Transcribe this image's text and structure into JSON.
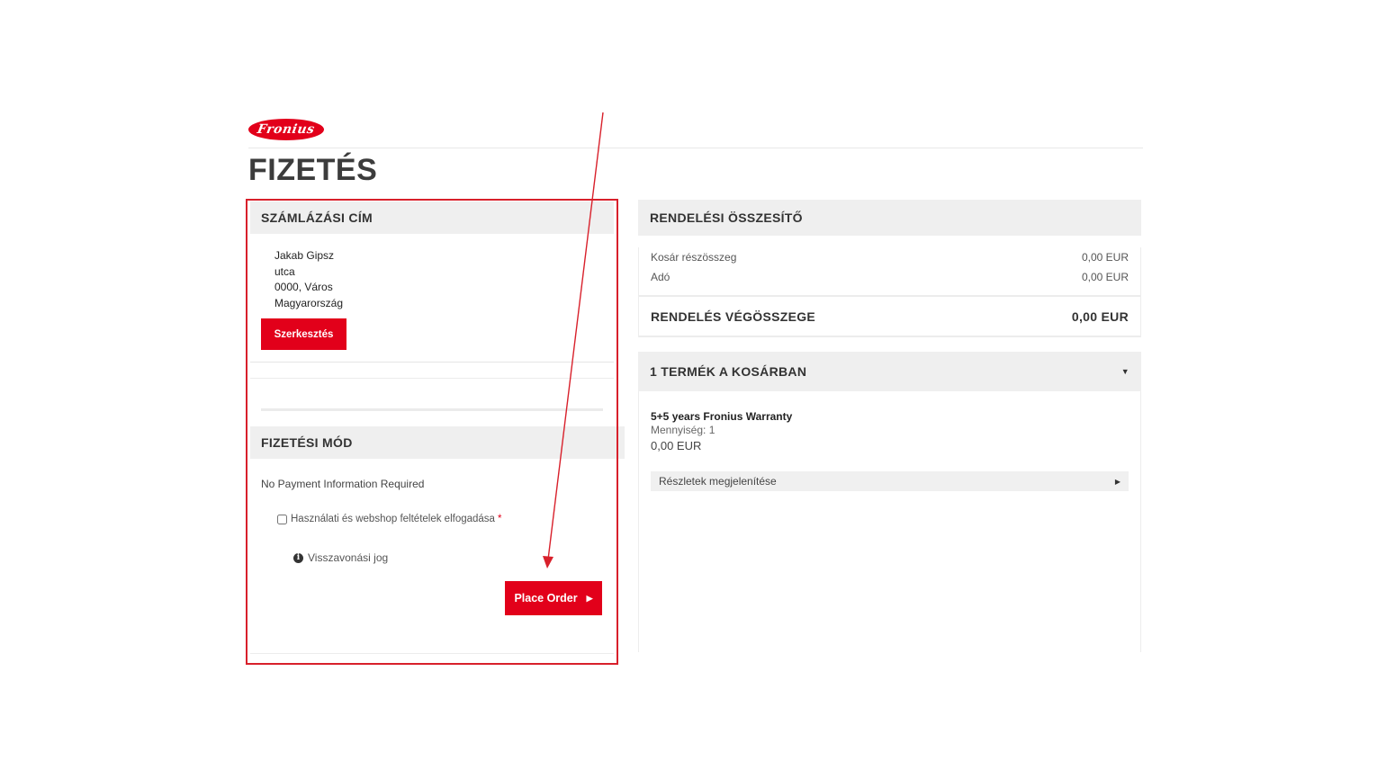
{
  "brand": {
    "logo_text": "Fronius",
    "accent_color": "#e2001a"
  },
  "page": {
    "title": "FIZETÉS"
  },
  "billing": {
    "header": "SZÁMLÁZÁSI CÍM",
    "name": "Jakab Gipsz",
    "street": "utca",
    "city": "0000, Város",
    "country": "Magyarország",
    "edit_label": "Szerkesztés"
  },
  "payment": {
    "header": "FIZETÉSI MÓD",
    "no_payment_text": "No Payment Information Required",
    "terms_label": "Használati és webshop feltételek elfogadása",
    "required_mark": "*",
    "terms_checked": false,
    "withdrawal_label": "Visszavonási jog",
    "info_icon": "info-icon",
    "place_order_label": "Place Order",
    "place_order_icon": "caret-right-icon"
  },
  "summary": {
    "header": "RENDELÉSI ÖSSZESÍTŐ",
    "subtotal_label": "Kosár részösszeg",
    "subtotal_value": "0,00 EUR",
    "tax_label": "Adó",
    "tax_value": "0,00 EUR",
    "total_label": "RENDELÉS VÉGÖSSZEGE",
    "total_value": "0,00 EUR"
  },
  "cart": {
    "header": "1 TERMÉK A KOSÁRBAN",
    "header_icon": "caret-down-icon",
    "items": [
      {
        "name": "5+5 years Fronius Warranty",
        "quantity": "Mennyiség: 1",
        "price": "0,00 EUR",
        "details_label": "Részletek megjelenítése"
      }
    ]
  },
  "annotation": {
    "highlight_color": "#d8202b"
  }
}
